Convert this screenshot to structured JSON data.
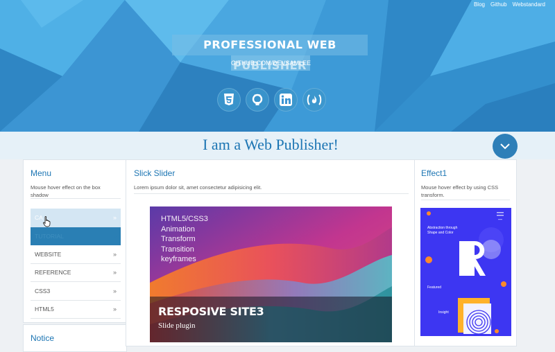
{
  "topnav": [
    "Blog",
    "Github",
    "Webstandard"
  ],
  "header": {
    "title": "PROFESSIONAL WEB PUBLISHER",
    "subtitle": "GITHUB.COM/DEVSAMLEE",
    "social": [
      "html5-icon",
      "github-icon",
      "linkedin-icon",
      "freecodecamp-icon"
    ]
  },
  "banner": {
    "text": "I am a Web Publisher!"
  },
  "menu_panel": {
    "title": "Menu",
    "description": "Mouse hover effect on the box shadow",
    "items": [
      {
        "label": "CA",
        "state": "hover"
      },
      {
        "label": "TUTORIAL",
        "state": "active"
      },
      {
        "label": "WEBSITE",
        "state": "normal"
      },
      {
        "label": "REFERENCE",
        "state": "normal"
      },
      {
        "label": "CSS3",
        "state": "normal"
      },
      {
        "label": "HTML5",
        "state": "normal"
      }
    ],
    "chevron": "»"
  },
  "notice_panel": {
    "title": "Notice"
  },
  "slider_panel": {
    "title": "Slick Slider",
    "description": "Lorem ipsum dolor sit, amet consectetur adipisicing elit.",
    "topics": [
      "HTML5/CSS3",
      "Animation",
      "Transform",
      "Transition",
      "keyframes"
    ],
    "caption_title": "RESPOSIVE SITE3",
    "caption_sub": "Slide plugin"
  },
  "effect_panel": {
    "title": "Effect1",
    "description": "Mouse hover effect by using CSS transform.",
    "image": {
      "heading": "Abstraction through Shape and Color",
      "letter": "R",
      "featured": "Featured",
      "card": "Insight"
    }
  },
  "colors": {
    "accent": "#1c75b3",
    "hero": "#3a9ad6",
    "menu_active": "#2a7fb4"
  }
}
